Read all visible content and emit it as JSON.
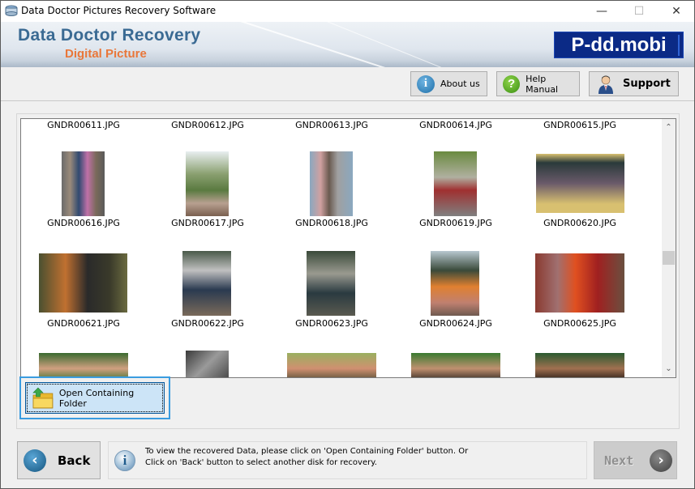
{
  "window": {
    "title": "Data Doctor Pictures Recovery Software",
    "controls": {
      "minimize": "—",
      "maximize": "☐",
      "close": "✕"
    }
  },
  "banner": {
    "brand_main": "Data Doctor Recovery",
    "brand_sub": "Digital Picture",
    "logo_text": "P-dd.mobi"
  },
  "toolbar": {
    "about_label": "About us",
    "help_label": "Help Manual",
    "support_label": "Support"
  },
  "gallery": {
    "rows": [
      {
        "files": [
          "GNDR00611.JPG",
          "GNDR00612.JPG",
          "GNDR00613.JPG",
          "GNDR00614.JPG",
          "GNDR00615.JPG"
        ]
      },
      {
        "files": [
          "GNDR00616.JPG",
          "GNDR00617.JPG",
          "GNDR00618.JPG",
          "GNDR00619.JPG",
          "GNDR00620.JPG"
        ]
      },
      {
        "files": [
          "GNDR00621.JPG",
          "GNDR00622.JPG",
          "GNDR00623.JPG",
          "GNDR00624.JPG",
          "GNDR00625.JPG"
        ]
      }
    ],
    "scroll_up": "⌃",
    "scroll_down": "⌄"
  },
  "actions": {
    "open_folder_label": "Open Containing Folder"
  },
  "footer": {
    "back_label": "Back",
    "next_label": "Next",
    "info_line1": "To view the recovered Data, please click on 'Open Containing Folder' button. Or",
    "info_line2": "Click on 'Back' button to select another disk for recovery."
  },
  "colors": {
    "brand_blue": "#3a6a93",
    "brand_orange": "#e9773a",
    "logo_bg": "#0b2a86",
    "focus_border": "#3a9ce0"
  }
}
